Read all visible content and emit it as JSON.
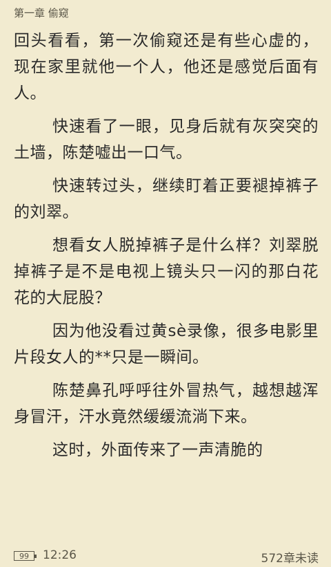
{
  "chapter_title": "第一章 偷窥",
  "paragraphs": [
    {
      "text": "回头看看，第一次偷窥还是有些心虚的，现在家里就他一个人，他还是感觉后面有人。",
      "indent": false
    },
    {
      "text": "快速看了一眼，见身后就有灰突突的土墙，陈楚嘘出一口气。",
      "indent": true
    },
    {
      "text": "快速转过头，继续盯着正要褪掉裤子的刘翠。",
      "indent": true
    },
    {
      "text": "想看女人脱掉裤子是什么样？刘翠脱掉裤子是不是电视上镜头只一闪的那白花花的大屁股？",
      "indent": true
    },
    {
      "text": "因为他没看过黄sè录像，很多电影里片段女人的**只是一瞬间。",
      "indent": true
    },
    {
      "text": "陈楚鼻孔呼呼往外冒热气，越想越浑身冒汗，汗水竟然缓缓流淌下来。",
      "indent": true
    },
    {
      "text": "这时，外面传来了一声清脆的",
      "indent": true
    }
  ],
  "status": {
    "battery": "99",
    "time": "12:26",
    "remaining": "572章未读"
  }
}
